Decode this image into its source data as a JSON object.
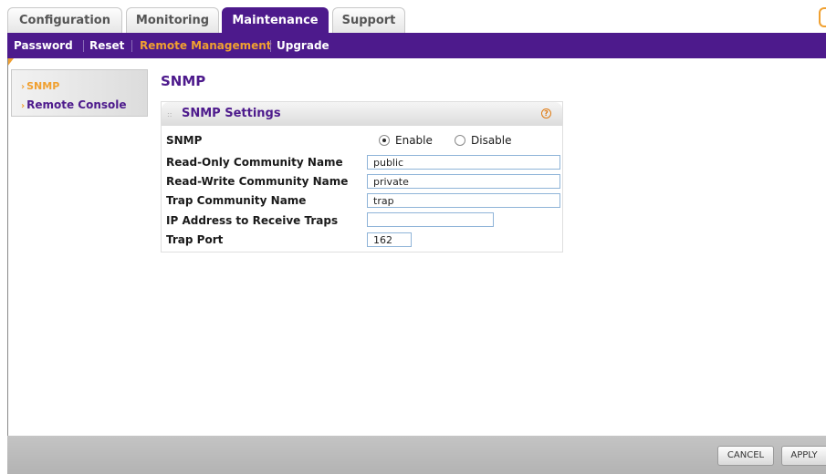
{
  "top_tabs": {
    "configuration": "Configuration",
    "monitoring": "Monitoring",
    "maintenance": "Maintenance",
    "support": "Support",
    "active": "Maintenance"
  },
  "sub_nav": {
    "password": "Password",
    "reset": "Reset",
    "remote_management": "Remote Management",
    "upgrade": "Upgrade",
    "active": "Remote Management"
  },
  "side_menu": {
    "snmp": "SNMP",
    "remote_console": "Remote Console",
    "active": "SNMP"
  },
  "page": {
    "title": "SNMP"
  },
  "panel": {
    "title": "SNMP Settings",
    "help_icon": "help-icon"
  },
  "form": {
    "snmp_label": "SNMP",
    "enable_label": "Enable",
    "disable_label": "Disable",
    "snmp_selected": "Enable",
    "read_only_label": "Read-Only Community Name",
    "read_only_value": "public",
    "read_write_label": "Read-Write Community Name",
    "read_write_value": "private",
    "trap_community_label": "Trap Community Name",
    "trap_community_value": "trap",
    "ip_label": "IP Address to Receive Traps",
    "ip_value": "",
    "trap_port_label": "Trap Port",
    "trap_port_value": "162"
  },
  "buttons": {
    "cancel": "CANCEL",
    "apply": "APPLY"
  },
  "colors": {
    "brand_purple": "#4d1a8c",
    "accent_orange": "#f0a030",
    "field_border": "#8fb4d8",
    "bottom_bar": "#bcbcbc"
  }
}
